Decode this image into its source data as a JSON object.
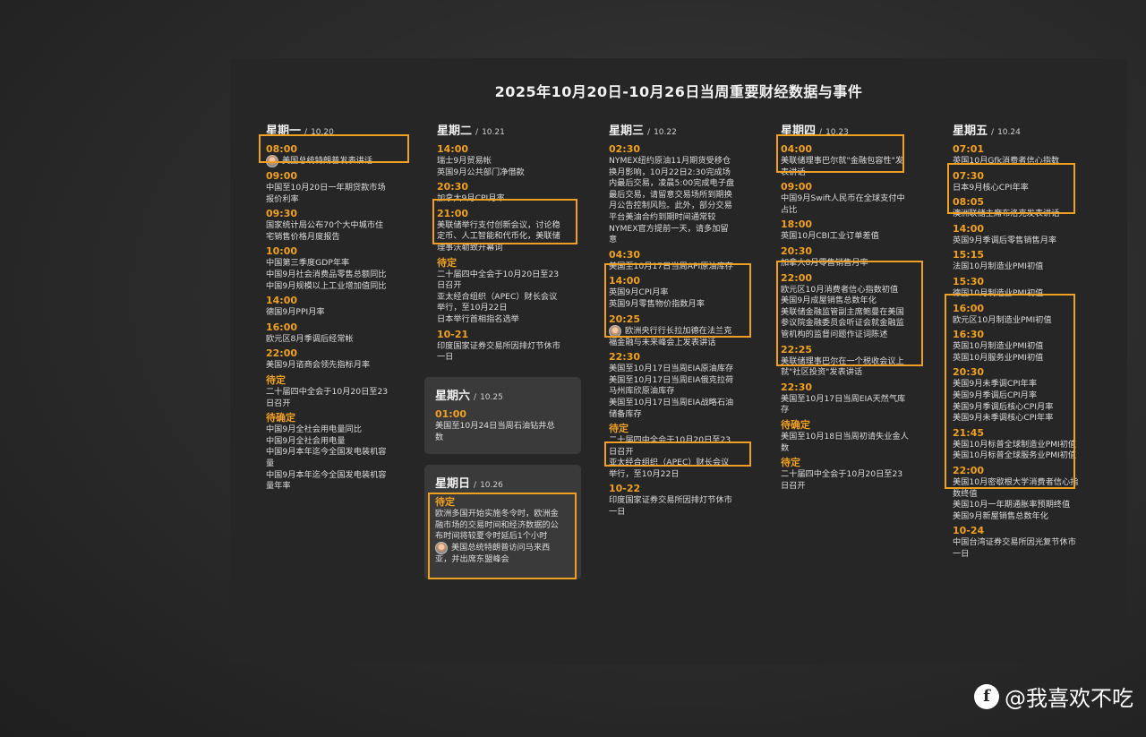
{
  "title": "2025年10月20日-10月26日当周重要财经数据与事件",
  "days": {
    "mon": {
      "name": "星期一",
      "date": "10.20",
      "events": [
        {
          "time": "08:00",
          "lines": [
            "美国总统特朗普发表讲话"
          ]
        },
        {
          "time": "09:00",
          "lines": [
            "中国至10月20日一年期贷款市场",
            "报价利率"
          ]
        },
        {
          "time": "09:30",
          "lines": [
            "国家统计局公布70个大中城市住",
            "宅销售价格月度报告"
          ]
        },
        {
          "time": "10:00",
          "lines": [
            "中国第三季度GDP年率",
            "中国9月社会消费品零售总额同比",
            "中国9月规模以上工业增加值同比"
          ]
        },
        {
          "time": "14:00",
          "lines": [
            "德国9月PPI月率"
          ]
        },
        {
          "time": "16:00",
          "lines": [
            "欧元区8月季调后经常帐"
          ]
        },
        {
          "time": "22:00",
          "lines": [
            "美国9月谘商会领先指标月率"
          ]
        },
        {
          "time": "待定",
          "lines": [
            "二十届四中全会于10月20日至23",
            "日召开"
          ]
        },
        {
          "time": "待确定",
          "lines": [
            "中国9月全社会用电量同比",
            "中国9月全社会用电量",
            "中国9月本年迄今全国发电装机容",
            "量",
            "中国9月本年迄今全国发电装机容",
            "量年率"
          ]
        }
      ]
    },
    "tue": {
      "name": "星期二",
      "date": "10.21",
      "events": [
        {
          "time": "14:00",
          "lines": [
            "瑞士9月贸易帐",
            "英国9月公共部门净借款"
          ]
        },
        {
          "time": "20:30",
          "lines": [
            "加拿大9月CPI月率"
          ]
        },
        {
          "time": "21:00",
          "lines": [
            "美联储举行支付创新会议，讨论稳",
            "定币、人工智能和代币化，美联储",
            "理事沃勒致开幕词"
          ]
        },
        {
          "time": "待定",
          "lines": [
            "二十届四中全会于10月20日至23",
            "日召开",
            "亚太经合组织（APEC）财长会议",
            "举行，至10月22日",
            "日本举行首相指名选举"
          ]
        },
        {
          "time": "10-21",
          "lines": [
            "印度国家证券交易所因排灯节休市",
            "一日"
          ]
        }
      ]
    },
    "wed": {
      "name": "星期三",
      "date": "10.22",
      "events": [
        {
          "time": "02:30",
          "lines": [
            "NYMEX纽约原油11月期货受移仓",
            "换月影响，10月22日2:30完成场",
            "内最后交易，凌晨5:00完成电子盘",
            "最后交易，请留意交易场所到期换",
            "月公告控制风险。此外，部分交易",
            "平台美油合约到期时间通常较",
            "NYMEX官方提前一天，请多加留",
            "意"
          ]
        },
        {
          "time": "04:30",
          "lines": [
            "美国至10月17日当周API原油库存"
          ]
        },
        {
          "time": "14:00",
          "lines": [
            "英国9月CPI月率",
            "英国9月零售物价指数月率"
          ]
        },
        {
          "time": "20:25",
          "lines": [
            "欧洲央行行长拉加德在法兰克",
            "福金融与未来峰会上发表讲话"
          ]
        },
        {
          "time": "22:30",
          "lines": [
            "美国至10月17日当周EIA原油库存",
            "美国至10月17日当周EIA俄克拉荷",
            "马州库欣原油库存",
            "美国至10月17日当周EIA战略石油",
            "储备库存"
          ]
        },
        {
          "time": "待定",
          "lines": [
            "二十届四中全会于10月20日至23",
            "日召开",
            "亚太经合组织（APEC）财长会议",
            "举行，至10月22日"
          ]
        },
        {
          "time": "10-22",
          "lines": [
            "印度国家证券交易所因排灯节休市",
            "一日"
          ]
        }
      ]
    },
    "thu": {
      "name": "星期四",
      "date": "10.23",
      "events": [
        {
          "time": "04:00",
          "lines": [
            "美联储理事巴尔就\"金融包容性\"发",
            "表讲话"
          ]
        },
        {
          "time": "09:00",
          "lines": [
            "中国9月Swift人民币在全球支付中",
            "占比"
          ]
        },
        {
          "time": "18:00",
          "lines": [
            "英国10月CBI工业订单差值"
          ]
        },
        {
          "time": "20:30",
          "lines": [
            "加拿大8月零售销售月率"
          ]
        },
        {
          "time": "22:00",
          "lines": [
            "欧元区10月消费者信心指数初值",
            "美国9月成屋销售总数年化",
            "美联储金融监管副主席鲍曼在美国",
            "参议院金融委员会听证会就金融监",
            "管机构的监督问题作证词陈述"
          ]
        },
        {
          "time": "22:25",
          "lines": [
            "美联储理事巴尔在一个税收会议上",
            "就\"社区投资\"发表讲话"
          ]
        },
        {
          "time": "22:30",
          "lines": [
            "美国至10月17日当周EIA天然气库",
            "存"
          ]
        },
        {
          "time": "待确定",
          "lines": [
            "美国至10月18日当周初请失业金人",
            "数"
          ]
        },
        {
          "time": "待定",
          "lines": [
            "二十届四中全会于10月20日至23",
            "日召开"
          ]
        }
      ]
    },
    "fri": {
      "name": "星期五",
      "date": "10.24",
      "events": [
        {
          "time": "07:01",
          "lines": [
            "英国10月Gfk消费者信心指数"
          ]
        },
        {
          "time": "07:30",
          "lines": [
            "日本9月核心CPI年率"
          ]
        },
        {
          "time": "08:05",
          "lines": [
            "澳洲联储主席布洛克发表讲话"
          ]
        },
        {
          "time": "14:00",
          "lines": [
            "英国9月季调后零售销售月率"
          ]
        },
        {
          "time": "15:15",
          "lines": [
            "法国10月制造业PMI初值"
          ]
        },
        {
          "time": "15:30",
          "lines": [
            "德国10月制造业PMI初值"
          ]
        },
        {
          "time": "16:00",
          "lines": [
            "欧元区10月制造业PMI初值"
          ]
        },
        {
          "time": "16:30",
          "lines": [
            "英国10月制造业PMI初值",
            "英国10月服务业PMI初值"
          ]
        },
        {
          "time": "20:30",
          "lines": [
            "美国9月未季调CPI年率",
            "美国9月季调后CPI月率",
            "美国9月季调后核心CPI月率",
            "美国9月未季调核心CPI年率"
          ]
        },
        {
          "time": "21:45",
          "lines": [
            "美国10月标普全球制造业PMI初值",
            "美国10月标普全球服务业PMI初值"
          ]
        },
        {
          "time": "22:00",
          "lines": [
            "美国10月密歇根大学消费者信心指",
            "数终值",
            "美国10月一年期通胀率预期终值",
            "美国9月新屋销售总数年化"
          ]
        },
        {
          "time": "10-24",
          "lines": [
            "中国台湾证券交易所因光复节休市",
            "一日"
          ]
        }
      ]
    },
    "sat": {
      "name": "星期六",
      "date": "10.25",
      "events": [
        {
          "time": "01:00",
          "lines": [
            "美国至10月24日当周石油钻井总",
            "数"
          ]
        }
      ]
    },
    "sun": {
      "name": "星期日",
      "date": "10.26",
      "events": [
        {
          "time": "待定",
          "lines": [
            "欧洲多国开始实施冬令时，欧洲金",
            "融市场的交易时间和经济数据的公",
            "布时间将较夏令时延后1个小时",
            "美国总统特朗普访问马来西",
            "亚，并出席东盟峰会"
          ]
        }
      ]
    }
  },
  "watermark": "@我喜欢不吃"
}
